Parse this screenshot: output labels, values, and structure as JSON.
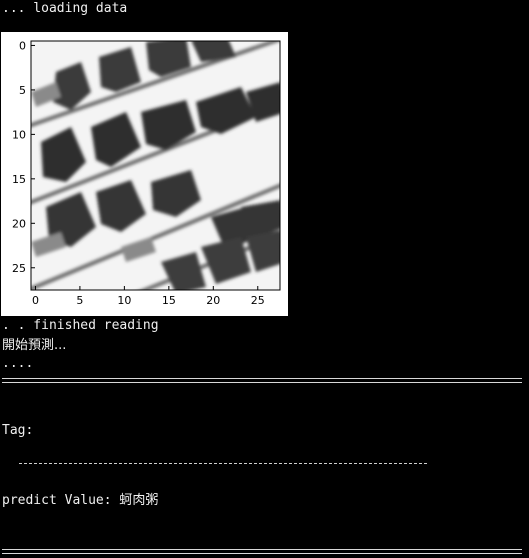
{
  "console": {
    "loading_line": "... loading data",
    "finished_line": ". . finished reading",
    "start_predict_line": "開始預測...",
    "dots_line": "....",
    "tag_label": "Tag:",
    "predict_label": "predict Value: ",
    "predict_value": "蚵肉粥"
  },
  "plot": {
    "x_ticks": [
      "0",
      "5",
      "10",
      "15",
      "20",
      "25"
    ],
    "y_ticks": [
      "0",
      "5",
      "10",
      "15",
      "20",
      "25"
    ],
    "colormap": "gray"
  }
}
